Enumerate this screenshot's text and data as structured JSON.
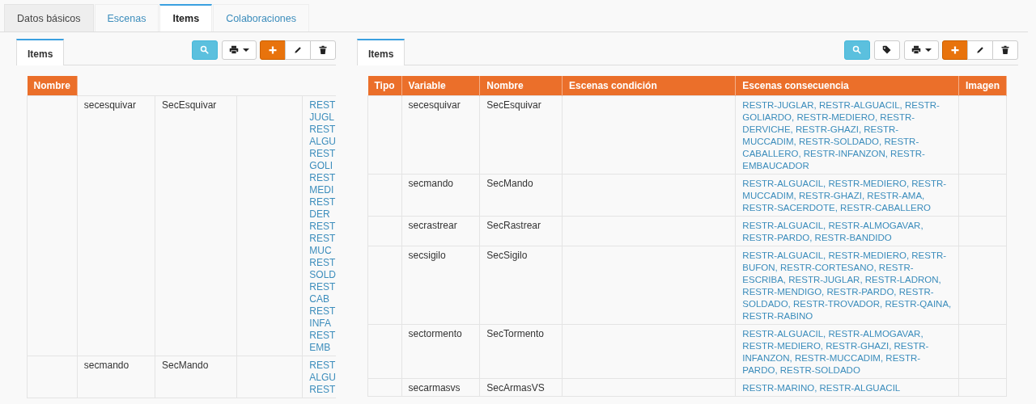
{
  "tabs": [
    {
      "label": "Datos básicos",
      "selected": false
    },
    {
      "label": "Escenas",
      "selected": false
    },
    {
      "label": "Items",
      "selected": true
    },
    {
      "label": "Colaboraciones",
      "selected": false
    }
  ],
  "left_panel": {
    "tabs": [
      {
        "label": "Items",
        "selected": true
      }
    ],
    "table": {
      "columns": [
        "Nombre"
      ],
      "rows": [
        {
          "variable": "secesquivar",
          "name": "SecEsquivar",
          "consequence_fragments": [
            "REST",
            "JUGL",
            "REST",
            "ALGU",
            "REST",
            "GOLI",
            "REST",
            "MEDI",
            "REST",
            "DER",
            "REST",
            "REST",
            "MUC",
            "REST",
            "SOLD",
            "REST",
            "CAB",
            "REST",
            "INFA",
            "REST",
            "EMB"
          ]
        },
        {
          "variable": "secmando",
          "name": "SecMando",
          "consequence_fragments": [
            "REST",
            "ALGU",
            "REST"
          ]
        }
      ]
    }
  },
  "right_panel": {
    "tabs": [
      {
        "label": "Items",
        "selected": true
      }
    ],
    "table": {
      "columns": [
        "Tipo",
        "Variable",
        "Nombre",
        "Escenas condición",
        "Escenas consecuencia",
        "Imagen"
      ],
      "rows": [
        {
          "variable": "secesquivar",
          "name": "SecEsquivar",
          "consequences": "RESTR-JUGLAR, RESTR-ALGUACIL, RESTR-GOLIARDO, RESTR-MEDIERO, RESTR-DERVICHE, RESTR-GHAZI, RESTR-MUCCADIM, RESTR-SOLDADO, RESTR-CABALLERO, RESTR-INFANZON, RESTR-EMBAUCADOR"
        },
        {
          "variable": "secmando",
          "name": "SecMando",
          "consequences": "RESTR-ALGUACIL, RESTR-MEDIERO, RESTR-MUCCADIM, RESTR-GHAZI, RESTR-AMA, RESTR-SACERDOTE, RESTR-CABALLERO"
        },
        {
          "variable": "secrastrear",
          "name": "SecRastrear",
          "consequences": "RESTR-ALGUACIL, RESTR-ALMOGAVAR, RESTR-PARDO, RESTR-BANDIDO"
        },
        {
          "variable": "secsigilo",
          "name": "SecSigilo",
          "consequences": "RESTR-ALGUACIL, RESTR-MEDIERO, RESTR-BUFON, RESTR-CORTESANO, RESTR-ESCRIBA, RESTR-JUGLAR, RESTR-LADRON, RESTR-MENDIGO, RESTR-PARDO, RESTR-SOLDADO, RESTR-TROVADOR, RESTR-QAINA, RESTR-RABINO"
        },
        {
          "variable": "sectormento",
          "name": "SecTormento",
          "consequences": "RESTR-ALGUACIL, RESTR-ALMOGAVAR, RESTR-MEDIERO, RESTR-GHAZI, RESTR-INFANZON, RESTR-MUCCADIM, RESTR-PARDO, RESTR-SOLDADO"
        },
        {
          "variable": "secarmasvs",
          "name": "SecArmasVS",
          "consequences": "RESTR-MARINO, RESTR-ALGUACIL"
        }
      ]
    }
  }
}
